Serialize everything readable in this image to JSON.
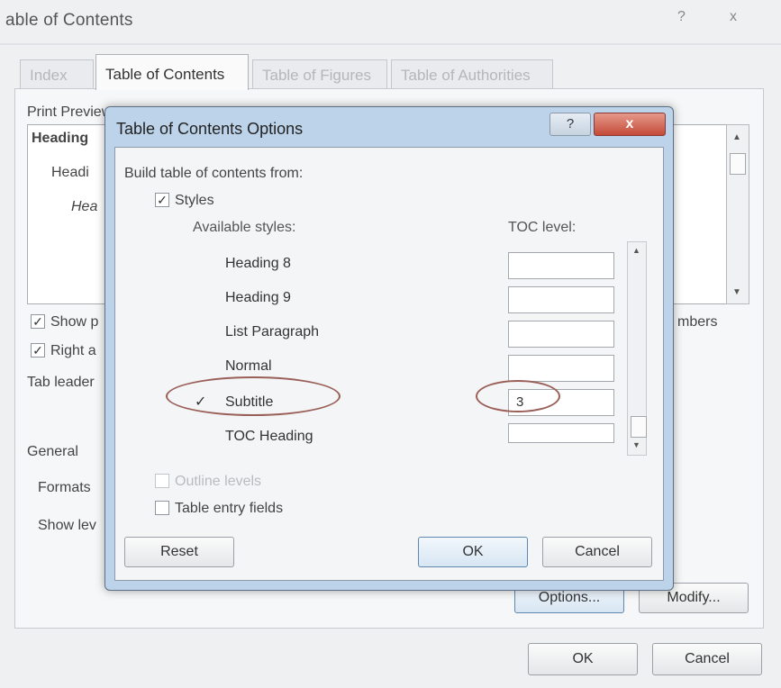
{
  "outer": {
    "title": "able of Contents",
    "tabs": [
      {
        "label": "Index"
      },
      {
        "label": "Table of Contents"
      },
      {
        "label": "Table of Figures"
      },
      {
        "label": "Table of Authorities"
      }
    ],
    "print_preview_label": "Print Preview",
    "preview_heading": "Heading",
    "preview_sub1": "Headi",
    "preview_sub2": "Hea",
    "show_page_numbers_label": "Show p",
    "right_align_label": "Right a",
    "tab_leader_label": "Tab leader",
    "page_numbers_suffix": "mbers",
    "general_label": "General",
    "formats_label": "Formats",
    "show_levels_label": "Show lev",
    "options_button": "Options...",
    "modify_button": "Modify...",
    "ok_button": "OK",
    "cancel_button": "Cancel",
    "ctrl_help": "?",
    "ctrl_close": "x"
  },
  "modal": {
    "title": "Table of Contents Options",
    "help": "?",
    "close": "x",
    "build_label": "Build table of contents from:",
    "styles_label": "Styles",
    "styles_checked": true,
    "available_styles_header": "Available styles:",
    "toc_level_header": "TOC level:",
    "styles": [
      {
        "name": "Heading 8",
        "level": "",
        "selected": false
      },
      {
        "name": "Heading 9",
        "level": "",
        "selected": false
      },
      {
        "name": "List Paragraph",
        "level": "",
        "selected": false
      },
      {
        "name": "Normal",
        "level": "",
        "selected": false
      },
      {
        "name": "Subtitle",
        "level": "3",
        "selected": true
      },
      {
        "name": "TOC Heading",
        "level": "",
        "selected": false
      }
    ],
    "outline_levels_label": "Outline levels",
    "table_entry_fields_label": "Table entry fields",
    "reset_button": "Reset",
    "ok_button": "OK",
    "cancel_button": "Cancel",
    "checkmark": "✓"
  }
}
